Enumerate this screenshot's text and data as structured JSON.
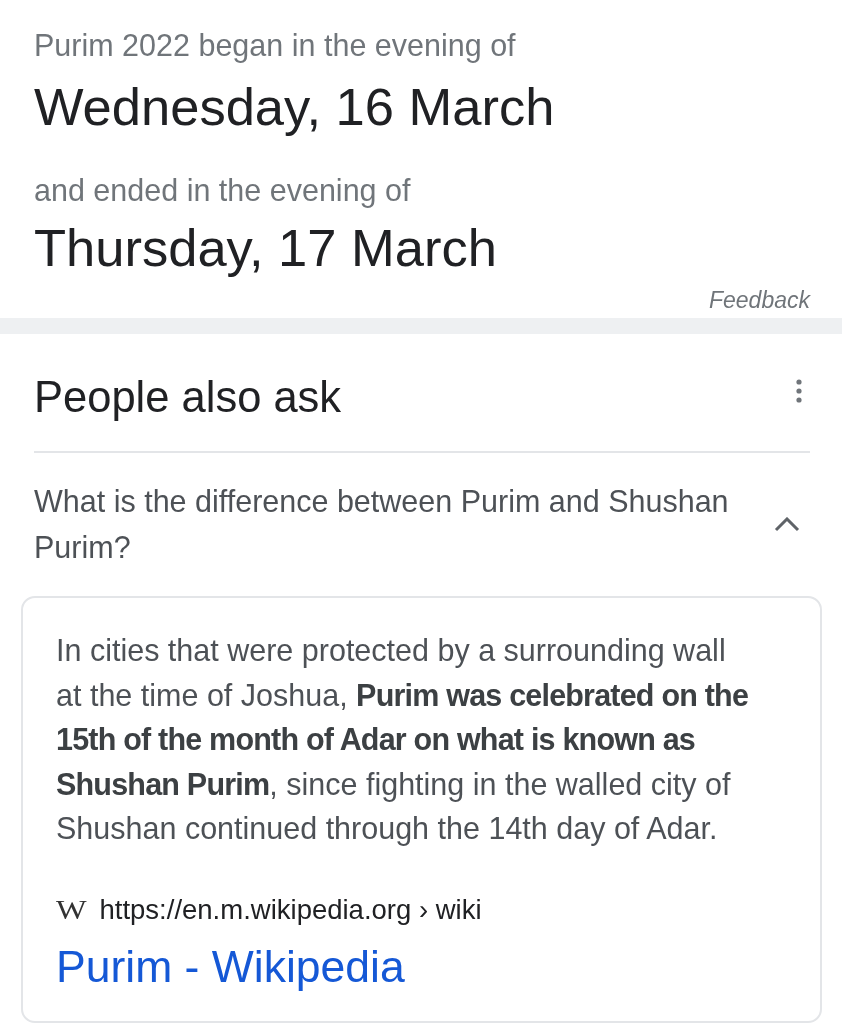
{
  "date_card": {
    "start_label": "Purim 2022 began in the evening of",
    "start_date": "Wednesday, 16 March",
    "end_label": "and ended in the evening of",
    "end_date": "Thursday, 17 March",
    "feedback": "Feedback"
  },
  "people_also_ask": {
    "title": "People also ask",
    "questions": [
      {
        "question": "What is the difference between Purim and Shushan Purim?",
        "expanded": true,
        "answer": "In cities that were protected by a surrounding wall at the time of Joshua, **Purim was celebrated on the 15th of the month of Adar on what is known as Shushan Purim**, since fighting in the walled city of Shushan continued through the 14th day of Adar.",
        "source": {
          "favicon_letter": "W",
          "url": "https://en.m.wikipedia.org › wiki",
          "title": "Purim - Wikipedia"
        }
      }
    ]
  }
}
